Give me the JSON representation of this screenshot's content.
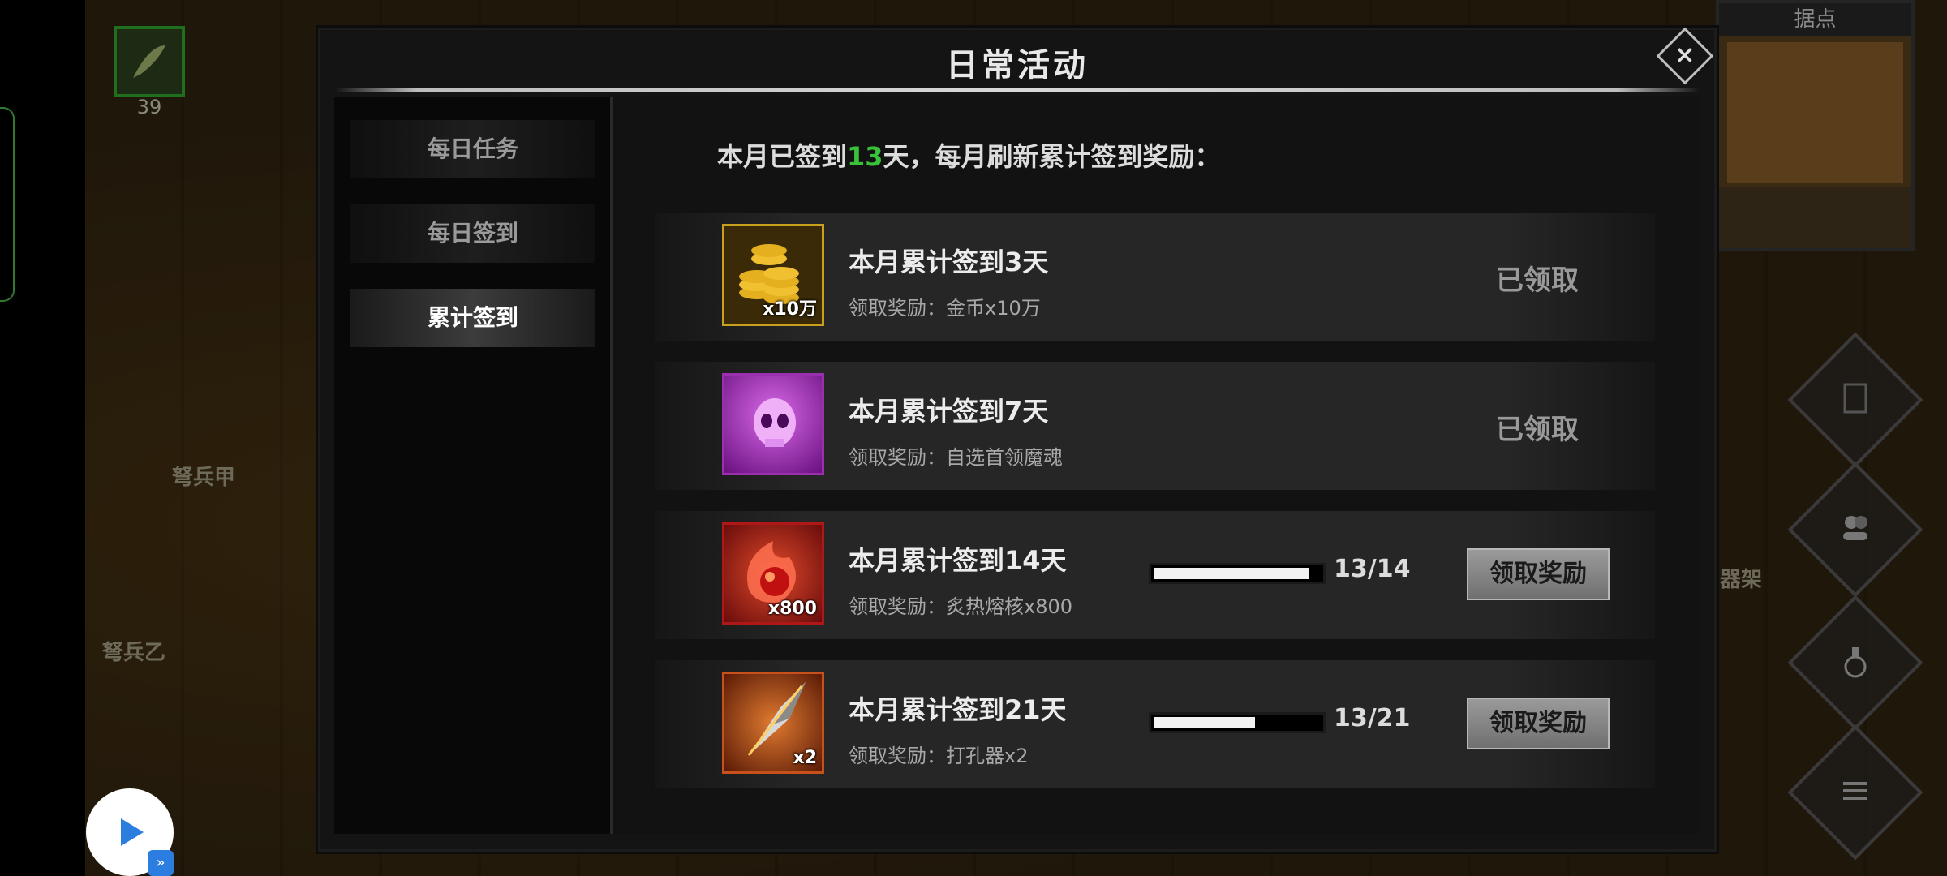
{
  "background": {
    "top_item_count": "39",
    "labels": [
      "弩兵甲",
      "弩兵乙",
      "器架"
    ],
    "map_title": "据点"
  },
  "dialog": {
    "title": "日常活动",
    "close_label": "×"
  },
  "tabs": [
    {
      "label": "每日任务",
      "active": false
    },
    {
      "label": "每日签到",
      "active": false
    },
    {
      "label": "累计签到",
      "active": true
    }
  ],
  "header": {
    "prefix": "本月已签到",
    "days": "13",
    "suffix": "天，每月刷新累计签到奖励："
  },
  "rewards": [
    {
      "title": "本月累计签到3天",
      "reward": "领取奖励：金币x10万",
      "qty": "x10万",
      "icon": "gold-coins-icon",
      "status": "已领取"
    },
    {
      "title": "本月累计签到7天",
      "reward": "领取奖励：自选首领魔魂",
      "qty": "",
      "icon": "purple-skull-icon",
      "status": "已领取"
    },
    {
      "title": "本月累计签到14天",
      "reward": "领取奖励：炙热熔核x800",
      "qty": "x800",
      "icon": "fire-core-icon",
      "progress": "13/14",
      "progress_value": 0.93,
      "button": "领取奖励"
    },
    {
      "title": "本月累计签到21天",
      "reward": "领取奖励：打孔器x2",
      "qty": "x2",
      "icon": "drill-blade-icon",
      "progress": "13/21",
      "progress_value": 0.62,
      "button": "领取奖励"
    }
  ],
  "colors": {
    "accent_green": "#3ac13a",
    "gold_border": "#c8a020",
    "purple_border": "#9a2fb0",
    "red_border": "#b01818",
    "orange_border": "#c8501a"
  }
}
